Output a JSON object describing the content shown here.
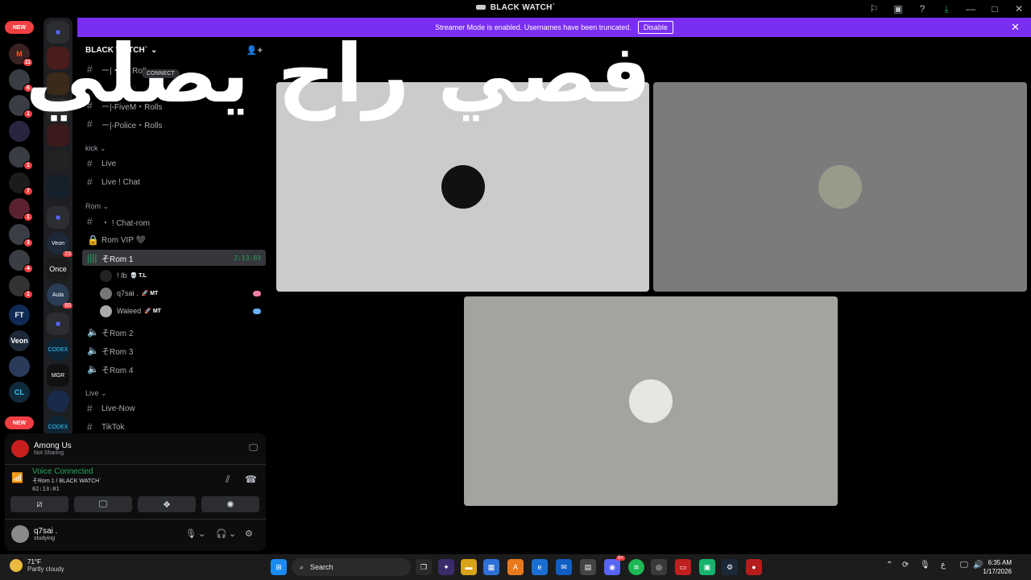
{
  "window": {
    "title": "BLACK WATCH`",
    "controls": {
      "minimize": "—",
      "maximize": "□",
      "close": "✕"
    }
  },
  "banner": {
    "text": "Streamer Mode is enabled. Usernames have been truncated.",
    "disable_label": "Disable",
    "close_label": "✕"
  },
  "server_rail": {
    "new_pill_top": "NEW",
    "new_pill_bottom": "NEW",
    "badges": [
      "11",
      "6",
      "1",
      "1",
      "1",
      "7",
      "1",
      "3",
      "4",
      "1"
    ],
    "labels": [
      "FT",
      "Veon",
      "CL"
    ],
    "folder_badges": [
      "23",
      "65"
    ],
    "folder_labels": [
      "Veon",
      "Once",
      "Aula",
      "CODEX",
      "MGR",
      "CODEX"
    ]
  },
  "sidebar": {
    "server_name": "BLACK WATCH`",
    "channels_top": [
      {
        "name": "ー|・L・Roll",
        "type": "text"
      },
      {
        "name": "ー|-FiveM・Rolls",
        "type": "text"
      },
      {
        "name": "ー|-Police・Rolls",
        "type": "text"
      }
    ],
    "jump_pill": "CONNECT",
    "category_kick": "kick",
    "kick_channels": [
      "Live",
      "Live ! Chat"
    ],
    "category_rom": "Rom",
    "rom_text": [
      "・ ! Chat-rom"
    ],
    "rom_vip": "Rom VIP 🖤",
    "active_channel": "そRom 1",
    "active_timer": "2:13:03",
    "members": [
      {
        "name": "! Ib",
        "tag": "💀 T.L"
      },
      {
        "name": "q7sai .",
        "tag": "🚀 MT"
      },
      {
        "name": "Waleed",
        "tag": "🚀 MT"
      }
    ],
    "voice_channels": [
      "そRom 2",
      "そRom 3",
      "そRom 4"
    ],
    "category_live": "Live",
    "live_channels": [
      "Live-Now",
      "TikTok"
    ]
  },
  "panel": {
    "game_name": "Among Us",
    "game_status": "Not Sharing",
    "voice_title": "Voice Connected",
    "voice_channel": "そRom 1 / BLACK WATCH`",
    "voice_time": "02:13:01",
    "user_name": "q7sai .",
    "user_status": "studying"
  },
  "overlay_text": "فصي راح يصلي",
  "taskbar": {
    "temp": "71°F",
    "condition": "Partly cloudy",
    "search_placeholder": "Search",
    "time": "6:35 AM",
    "date": "1/17/2026",
    "lang": "ع",
    "discord_badge": "9+"
  },
  "colors": {
    "banner": "#7a2ef2",
    "voice_green": "#23a55a",
    "badge_red": "#f23f43",
    "tile_1": "#cbcbcb",
    "tile_2": "#7b7b7b",
    "tile_3": "#a3a3a0"
  }
}
